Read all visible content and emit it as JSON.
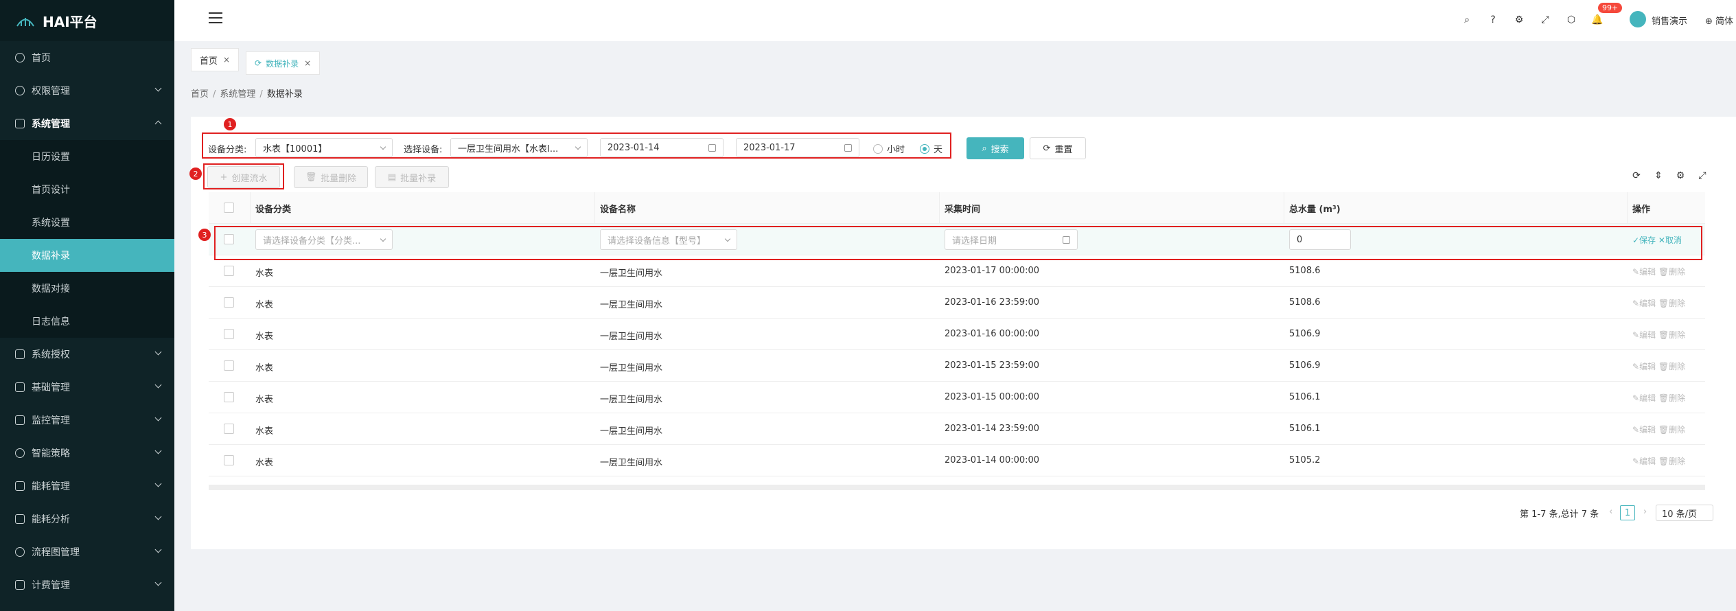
{
  "app": {
    "title": "HAI平台"
  },
  "sidebar": {
    "items": [
      {
        "label": "首页"
      },
      {
        "label": "权限管理"
      },
      {
        "label": "系统管理"
      },
      {
        "label": "系统授权"
      },
      {
        "label": "基础管理"
      },
      {
        "label": "监控管理"
      },
      {
        "label": "智能策略"
      },
      {
        "label": "能耗管理"
      },
      {
        "label": "能耗分析"
      },
      {
        "label": "流程图管理"
      },
      {
        "label": "计费管理"
      }
    ],
    "sub_items": [
      {
        "label": "日历设置"
      },
      {
        "label": "首页设计"
      },
      {
        "label": "系统设置"
      },
      {
        "label": "数据补录"
      },
      {
        "label": "数据对接"
      },
      {
        "label": "日志信息"
      }
    ]
  },
  "header": {
    "badge": "99+",
    "user": "销售演示",
    "lang": "简体"
  },
  "tabs": [
    {
      "label": "首页"
    },
    {
      "label": "数据补录"
    }
  ],
  "breadcrumb": [
    "首页",
    "系统管理",
    "数据补录"
  ],
  "annotations": [
    "1",
    "2",
    "3"
  ],
  "filter": {
    "category_label": "设备分类:",
    "category_value": "水表【10001】",
    "device_label": "选择设备:",
    "device_value": "一层卫生间用水【水表I...",
    "start_date": "2023-01-14",
    "end_date": "2023-01-17",
    "radio_hour": "小时",
    "radio_day": "天",
    "search": "搜索",
    "reset": "重置"
  },
  "toolbar": {
    "create": "创建流水",
    "batch_delete": "批量删除",
    "batch_add": "批量补录"
  },
  "table": {
    "columns": [
      "设备分类",
      "设备名称",
      "采集时间",
      "总水量 (m³)",
      "操作"
    ],
    "edit_row": {
      "category_placeholder": "请选择设备分类【分类...",
      "device_placeholder": "请选择设备信息【型号】",
      "date_placeholder": "请选择日期",
      "total_value": "0",
      "save": "✓保存",
      "cancel": "✕取消"
    },
    "rows": [
      {
        "category": "水表",
        "device": "一层卫生间用水",
        "time": "2023-01-17 00:00:00",
        "total": "5108.6"
      },
      {
        "category": "水表",
        "device": "一层卫生间用水",
        "time": "2023-01-16 23:59:00",
        "total": "5108.6"
      },
      {
        "category": "水表",
        "device": "一层卫生间用水",
        "time": "2023-01-16 00:00:00",
        "total": "5106.9"
      },
      {
        "category": "水表",
        "device": "一层卫生间用水",
        "time": "2023-01-15 23:59:00",
        "total": "5106.9"
      },
      {
        "category": "水表",
        "device": "一层卫生间用水",
        "time": "2023-01-15 00:00:00",
        "total": "5106.1"
      },
      {
        "category": "水表",
        "device": "一层卫生间用水",
        "time": "2023-01-14 23:59:00",
        "total": "5106.1"
      },
      {
        "category": "水表",
        "device": "一层卫生间用水",
        "time": "2023-01-14 00:00:00",
        "total": "5105.2"
      }
    ],
    "row_edit": "编辑",
    "row_delete": "删除"
  },
  "pagination": {
    "summary": "第 1-7 条,总计 7 条",
    "current": "1",
    "page_size": "10 条/页"
  }
}
